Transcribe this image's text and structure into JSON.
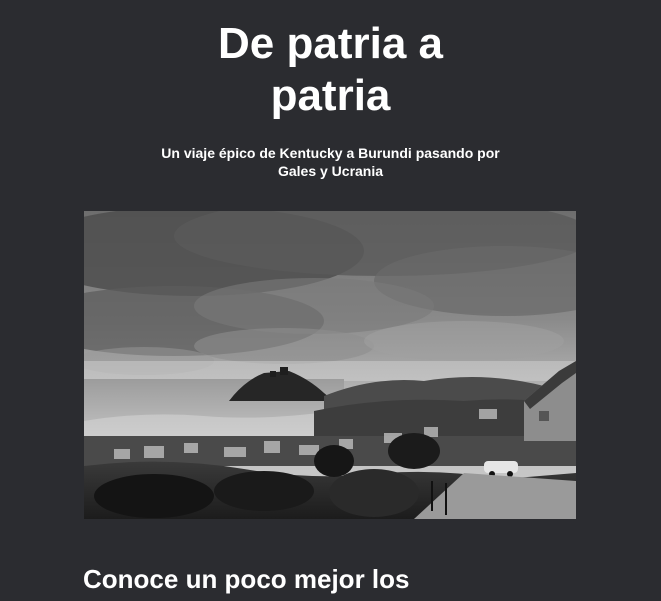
{
  "article": {
    "title_line1": "De patria a",
    "title_line2": "patria",
    "subtitle": "Un viaje épico de Kentucky a Burundi pasando por Gales y Ucrania",
    "hero_image": {
      "alt": "Vista en blanco y negro de un pueblo costero con un castillo sobre una colina y un cielo nublado"
    },
    "section_heading": "Conoce un poco mejor los"
  },
  "colors": {
    "background": "#2b2c30",
    "text": "#ffffff"
  }
}
